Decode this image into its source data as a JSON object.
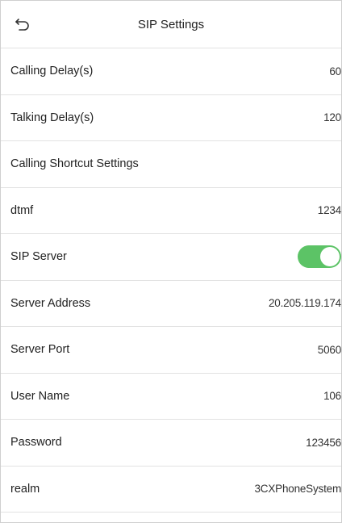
{
  "header": {
    "title": "SIP Settings"
  },
  "icons": {
    "back": "back-arrow-icon"
  },
  "rows": [
    {
      "label": "Calling Delay(s)",
      "value": "60"
    },
    {
      "label": "Talking Delay(s)",
      "value": "120"
    },
    {
      "label": "Calling Shortcut Settings",
      "value": ""
    },
    {
      "label": "dtmf",
      "value": "1234"
    },
    {
      "label": "SIP Server",
      "toggle": true
    },
    {
      "label": "Server Address",
      "value": "20.205.119.174"
    },
    {
      "label": "Server Port",
      "value": "5060"
    },
    {
      "label": "User Name",
      "value": "106"
    },
    {
      "label": "Password",
      "value": "123456"
    },
    {
      "label": "realm",
      "value": "3CXPhoneSystem"
    }
  ],
  "colors": {
    "toggle_on": "#5cc366"
  }
}
